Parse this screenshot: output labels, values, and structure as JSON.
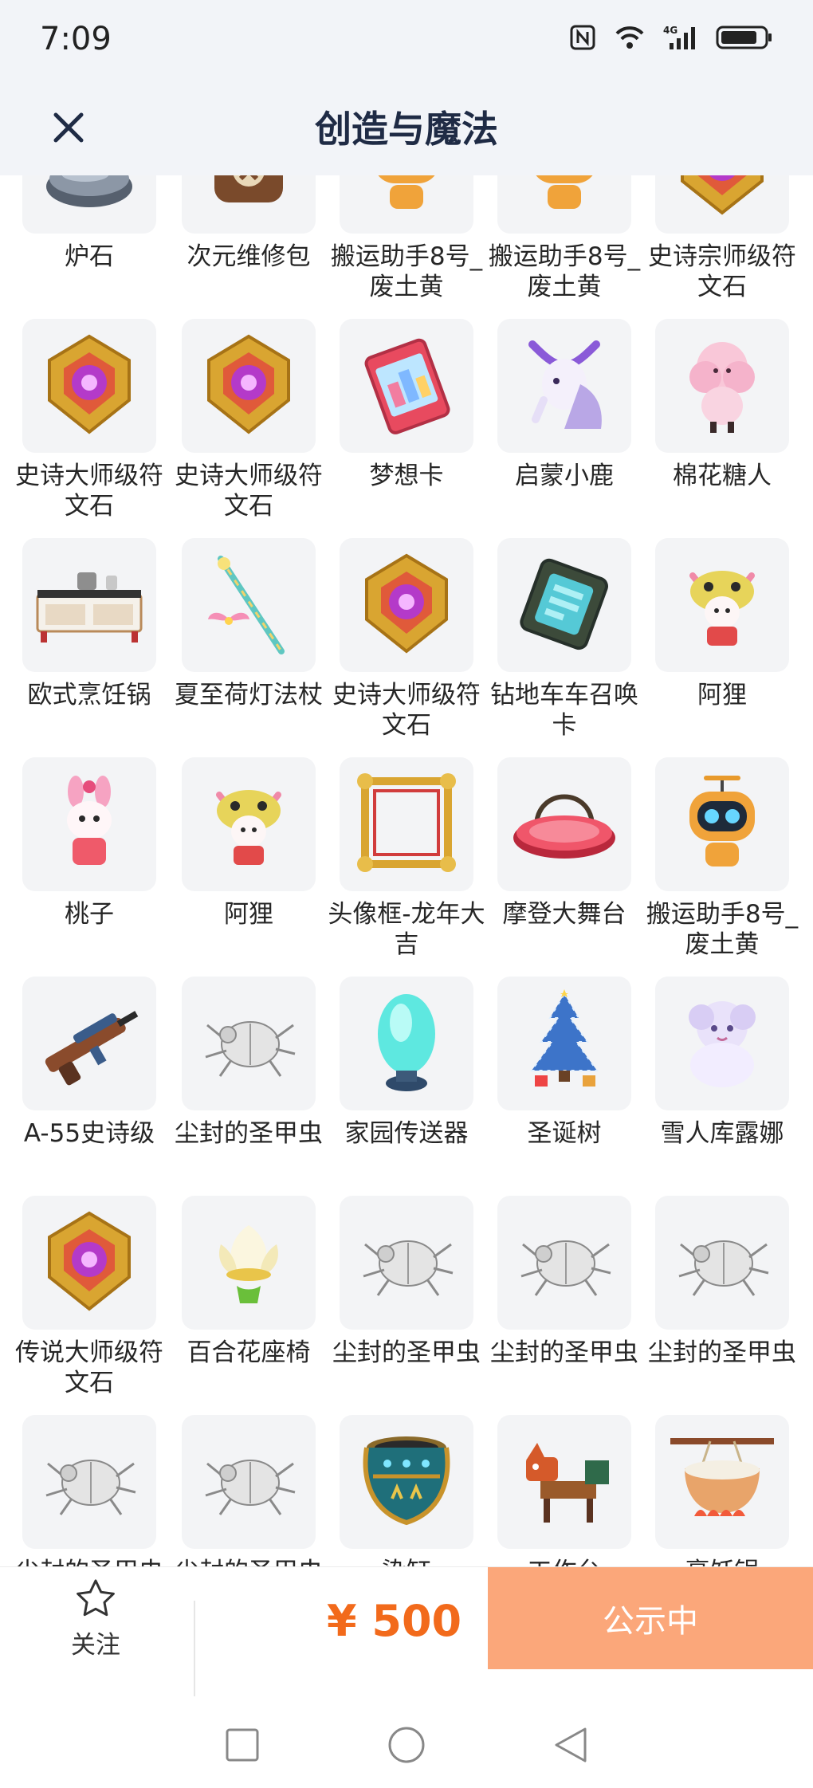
{
  "status_bar": {
    "time": "7:09",
    "network": "4G"
  },
  "header": {
    "title": "创造与魔法"
  },
  "items": [
    {
      "label": "炉石",
      "icon": "stone-icon"
    },
    {
      "label": "次元维修包",
      "icon": "repair-bag-icon"
    },
    {
      "label": "搬运助手8号_废土黄",
      "icon": "robot-icon"
    },
    {
      "label": "搬运助手8号_废土黄",
      "icon": "robot-icon"
    },
    {
      "label": "史诗宗师级符文石",
      "icon": "rune-stone-icon"
    },
    {
      "label": "史诗大师级符文石",
      "icon": "rune-stone-icon"
    },
    {
      "label": "史诗大师级符文石",
      "icon": "rune-stone-icon"
    },
    {
      "label": "梦想卡",
      "icon": "card-icon"
    },
    {
      "label": "启蒙小鹿",
      "icon": "deer-icon"
    },
    {
      "label": "棉花糖人",
      "icon": "cotton-candy-icon"
    },
    {
      "label": "欧式烹饪锅",
      "icon": "stove-icon"
    },
    {
      "label": "夏至荷灯法杖",
      "icon": "staff-icon"
    },
    {
      "label": "史诗大师级符文石",
      "icon": "rune-stone-icon"
    },
    {
      "label": "钻地车车召唤卡",
      "icon": "summon-card-icon"
    },
    {
      "label": "阿狸",
      "icon": "fox-doll-icon"
    },
    {
      "label": "桃子",
      "icon": "bunny-doll-icon"
    },
    {
      "label": "阿狸",
      "icon": "fox-doll-icon"
    },
    {
      "label": "头像框-龙年大吉",
      "icon": "frame-icon"
    },
    {
      "label": "摩登大舞台",
      "icon": "stage-icon"
    },
    {
      "label": "搬运助手8号_废土黄",
      "icon": "robot-icon"
    },
    {
      "label": "A-55史诗级",
      "icon": "gun-icon"
    },
    {
      "label": "尘封的圣甲虫",
      "icon": "beetle-icon"
    },
    {
      "label": "家园传送器",
      "icon": "teleporter-icon"
    },
    {
      "label": "圣诞树",
      "icon": "tree-icon"
    },
    {
      "label": "雪人库露娜",
      "icon": "snowman-icon"
    },
    {
      "label": "传说大师级符文石",
      "icon": "rune-stone-icon"
    },
    {
      "label": "百合花座椅",
      "icon": "lily-chair-icon"
    },
    {
      "label": "尘封的圣甲虫",
      "icon": "beetle-icon"
    },
    {
      "label": "尘封的圣甲虫",
      "icon": "beetle-icon"
    },
    {
      "label": "尘封的圣甲虫",
      "icon": "beetle-icon"
    },
    {
      "label": "尘封的圣甲虫",
      "icon": "beetle-icon"
    },
    {
      "label": "尘封的圣甲虫",
      "icon": "beetle-icon"
    },
    {
      "label": "染缸",
      "icon": "dye-vat-icon"
    },
    {
      "label": "工作台",
      "icon": "workbench-icon"
    },
    {
      "label": "烹饪锅",
      "icon": "cooking-pot-icon"
    }
  ],
  "bottom_bar": {
    "follow_label": "关注",
    "price": "¥ 500",
    "status_button": "公示中"
  },
  "colors": {
    "price": "#f26a1b",
    "status_button_bg": "#fba77a",
    "header_bg": "#f2f4f8"
  }
}
